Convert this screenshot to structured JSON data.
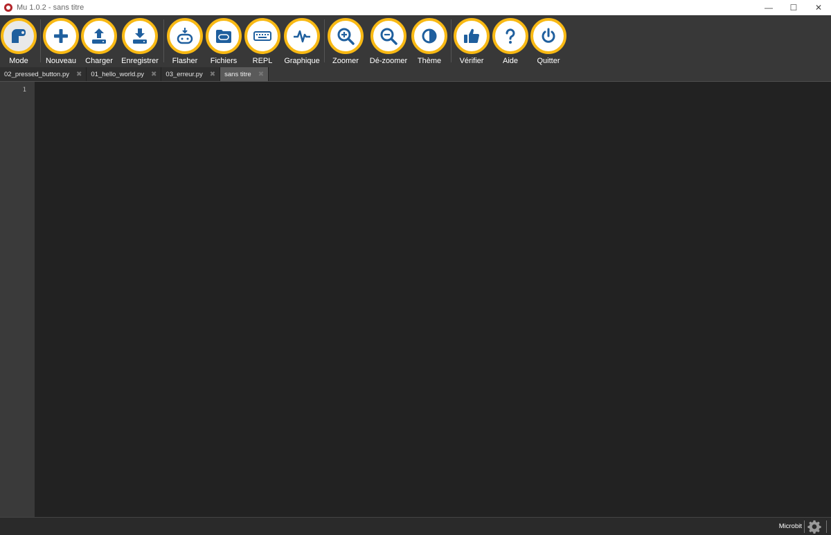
{
  "window": {
    "title": "Mu 1.0.2 - sans titre",
    "controls": {
      "minimize": "—",
      "maximize": "☐",
      "close": "✕"
    }
  },
  "toolbar": {
    "accent_color": "#f8b914",
    "icon_color": "#1f5f9e",
    "buttons": [
      {
        "id": "mode",
        "label": "Mode",
        "icon": "mode-icon"
      },
      {
        "id": "new",
        "label": "Nouveau",
        "icon": "plus-icon"
      },
      {
        "id": "load",
        "label": "Charger",
        "icon": "upload-icon"
      },
      {
        "id": "save",
        "label": "Enregistrer",
        "icon": "download-icon"
      },
      {
        "id": "flash",
        "label": "Flasher",
        "icon": "microbit-flash-icon"
      },
      {
        "id": "files",
        "label": "Fichiers",
        "icon": "folder-icon"
      },
      {
        "id": "repl",
        "label": "REPL",
        "icon": "keyboard-icon"
      },
      {
        "id": "plotter",
        "label": "Graphique",
        "icon": "pulse-icon"
      },
      {
        "id": "zoom_in",
        "label": "Zoomer",
        "icon": "zoom-in-icon"
      },
      {
        "id": "zoom_out",
        "label": "Dé-zoomer",
        "icon": "zoom-out-icon"
      },
      {
        "id": "theme",
        "label": "Thème",
        "icon": "contrast-icon"
      },
      {
        "id": "check",
        "label": "Vérifier",
        "icon": "thumbs-up-icon"
      },
      {
        "id": "help",
        "label": "Aide",
        "icon": "question-icon"
      },
      {
        "id": "quit",
        "label": "Quitter",
        "icon": "power-icon"
      }
    ]
  },
  "tabs": [
    {
      "label": "02_pressed_button.py",
      "close": "✖",
      "active": false
    },
    {
      "label": "01_hello_world.py",
      "close": "✖",
      "active": false
    },
    {
      "label": "03_erreur.py",
      "close": "✖",
      "active": false
    },
    {
      "label": "sans titre",
      "close": "✖",
      "active": true
    }
  ],
  "editor": {
    "line_numbers": [
      "1"
    ]
  },
  "statusbar": {
    "mode": "Microbit",
    "settings_icon": "gear-icon"
  }
}
